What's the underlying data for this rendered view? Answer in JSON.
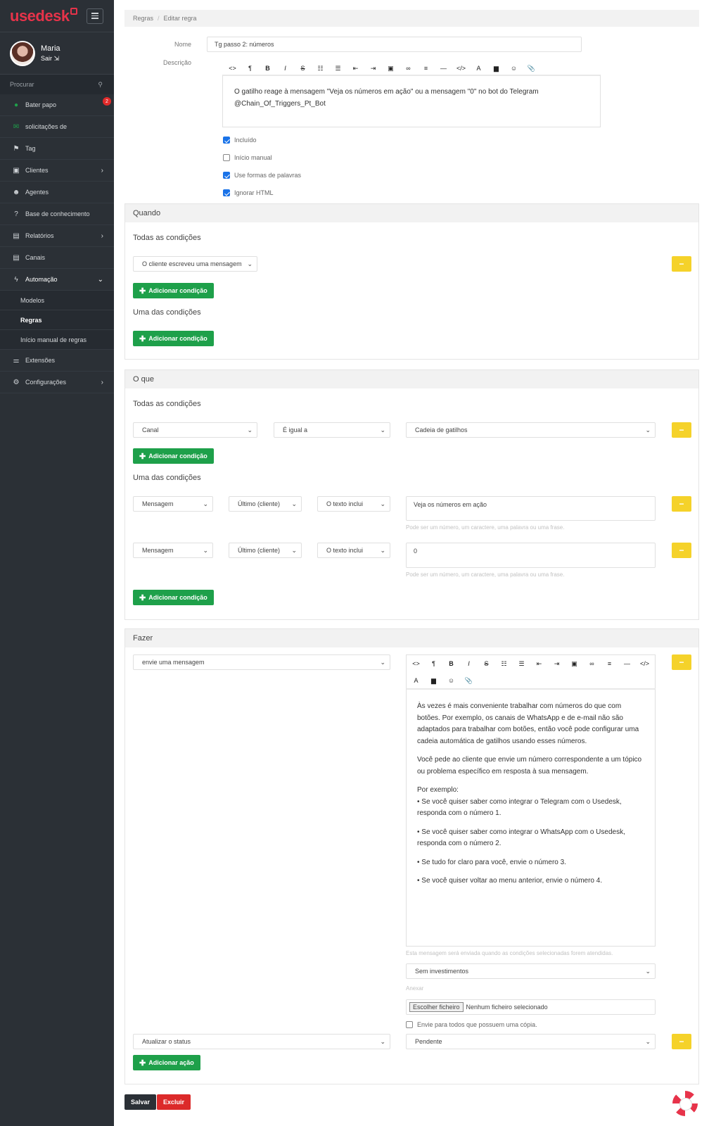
{
  "sidebar": {
    "logo": "usedesk",
    "user": {
      "name": "Maria",
      "exit": "Sair"
    },
    "search_placeholder": "Procurar",
    "items": [
      {
        "label": "Bater papo",
        "icon": "chat-icon",
        "badge": "2"
      },
      {
        "label": "solicitações de",
        "icon": "envelope-icon"
      },
      {
        "label": "Tag",
        "icon": "tag-icon"
      },
      {
        "label": "Clientes",
        "icon": "address-book-icon"
      },
      {
        "label": "Agentes",
        "icon": "user-icon"
      },
      {
        "label": "Base de conhecimento",
        "icon": "question-icon"
      },
      {
        "label": "Relatórios",
        "icon": "report-icon"
      },
      {
        "label": "Canais",
        "icon": "inbox-icon"
      },
      {
        "label": "Automação",
        "icon": "bolt-icon"
      }
    ],
    "sub_items": [
      "Modelos",
      "Regras",
      "Início manual de regras"
    ],
    "bottom_items": [
      {
        "label": "Extensões",
        "icon": "sliders-icon"
      },
      {
        "label": "Configurações",
        "icon": "gear-icon"
      }
    ]
  },
  "breadcrumb": {
    "root": "Regras",
    "sep": "/",
    "current": "Editar regra"
  },
  "form": {
    "name_label": "Nome",
    "name_value": "Tg passo 2: números",
    "desc_label": "Descrição",
    "toolbar": [
      "<>",
      "¶",
      "B",
      "I",
      "S",
      "☷",
      "☰",
      "⇤",
      "⇥",
      "▣",
      "∞",
      "≡",
      "—",
      "</>",
      "A",
      "▆",
      "☺",
      "📎"
    ],
    "desc_text": "O gatilho reage à mensagem \"Veja os números em ação\" ou a mensagem \"0\" no bot do Telegram @Chain_Of_Triggers_Pt_Bot",
    "checks": [
      {
        "label": "Incluído",
        "checked": true
      },
      {
        "label": "Início manual",
        "checked": false
      },
      {
        "label": "Use formas de palavras",
        "checked": true
      },
      {
        "label": "Ignorar HTML",
        "checked": true
      }
    ]
  },
  "when": {
    "title": "Quando",
    "all_title": "Todas as condições",
    "all_select": "O cliente escreveu uma mensagem",
    "add_condition": "Adicionar condição",
    "any_title": "Uma das condições"
  },
  "what": {
    "title": "O que",
    "all_title": "Todas as condições",
    "channel": {
      "field": "Canal",
      "op": "É igual a",
      "value": "Cadeia de gatilhos"
    },
    "add_condition": "Adicionar condição",
    "any_title": "Uma das condições",
    "conditions": [
      {
        "field": "Mensagem",
        "scope": "Último (cliente)",
        "op": "O texto inclui",
        "value": "Veja os números em ação"
      },
      {
        "field": "Mensagem",
        "scope": "Último (cliente)",
        "op": "O texto inclui",
        "value": "0"
      }
    ],
    "hint": "Pode ser um número, um caractere, uma palavra ou uma frase."
  },
  "do": {
    "title": "Fazer",
    "action1": "envie uma mensagem",
    "message_paragraphs": [
      "Às vezes é mais conveniente trabalhar com números do que com botões. Por exemplo, os canais de WhatsApp e de e-mail não são adaptados para trabalhar com botões, então você pode configurar uma cadeia automática de gatilhos usando esses números.",
      "Você pede ao cliente que envie um número correspondente a um tópico ou problema específico em resposta à sua mensagem.",
      "Por exemplo:\n• Se você quiser saber como integrar o Telegram com o Usedesk, responda com o número 1.",
      "• Se você quiser saber como integrar o WhatsApp com o Usedesk, responda com o número 2.",
      "• Se tudo for claro para você, envie o número 3.",
      "• Se você quiser voltar ao menu anterior, envie o número 4."
    ],
    "message_hint": "Esta mensagem será enviada quando as condições selecionadas forem atendidas.",
    "investments": "Sem investimentos",
    "attach_label": "Anexar",
    "file_button": "Escolher ficheiro",
    "file_none": "Nenhum ficheiro selecionado",
    "copy_label": "Envie para todos que possuem uma cópia.",
    "action2": "Atualizar o status",
    "status": "Pendente",
    "add_action": "Adicionar ação"
  },
  "footer": {
    "save": "Salvar",
    "delete": "Excluir"
  },
  "colors": {
    "sidebar": "#2b3036",
    "brand": "#e7334a",
    "green": "#1ea04a",
    "yellow": "#f5d22a",
    "red": "#dc2a2a"
  }
}
